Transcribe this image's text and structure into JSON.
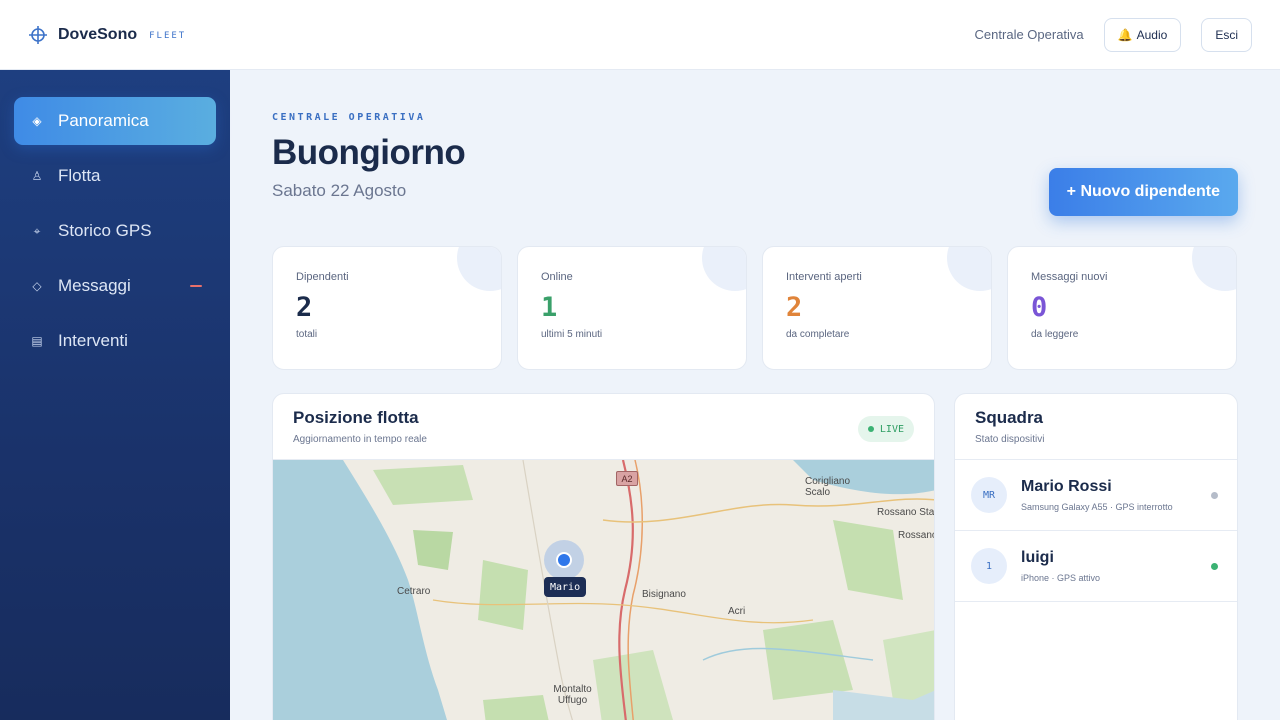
{
  "header": {
    "brand_name": "DoveSono",
    "brand_tag": "FLEET",
    "link_label": "Centrale Operativa",
    "audio_label": "Audio",
    "audio_icon": "🔔",
    "logout_label": "Esci"
  },
  "sidebar": {
    "items": [
      {
        "label": "Panoramica",
        "icon": "◈",
        "active": true
      },
      {
        "label": "Flotta",
        "icon": "♙"
      },
      {
        "label": "Storico GPS",
        "icon": "⌖"
      },
      {
        "label": "Messaggi",
        "icon": "◇"
      },
      {
        "label": "Interventi",
        "icon": "▤"
      }
    ]
  },
  "main": {
    "eyebrow": "CENTRALE OPERATIVA",
    "greeting": "Buongiorno",
    "date": "Sabato 22 Agosto",
    "new_button_label": "+ Nuovo dipendente"
  },
  "stats": [
    {
      "label": "Dipendenti",
      "value": "2",
      "sub": "totali",
      "color": "#1b2b4b"
    },
    {
      "label": "Online",
      "value": "1",
      "sub": "ultimi 5 minuti",
      "color": "#3aa06a"
    },
    {
      "label": "Interventi aperti",
      "value": "2",
      "sub": "da completare",
      "color": "#e0843a"
    },
    {
      "label": "Messaggi nuovi",
      "value": "0",
      "sub": "da leggere",
      "color": "#7a55d6"
    }
  ],
  "map_panel": {
    "title": "Posizione flotta",
    "subtitle": "Aggiornamento in tempo reale",
    "live_label": "LIVE",
    "marker_label": "Mario",
    "road_sign": "A2",
    "places": [
      "Corigliano Scalo",
      "Rossano Sta",
      "Rossano",
      "Cetraro",
      "Bisignano",
      "Acri",
      "Montalto Uffugo"
    ]
  },
  "team_panel": {
    "title": "Squadra",
    "subtitle": "Stato dispositivi",
    "members": [
      {
        "initials": "MR",
        "name": "Mario Rossi",
        "device": "Samsung Galaxy A55 · GPS interrotto",
        "status_color": "#b5bcc9"
      },
      {
        "initials": "1",
        "name": "luigi",
        "device": "iPhone · GPS attivo",
        "status_color": "#3bb273"
      }
    ]
  }
}
